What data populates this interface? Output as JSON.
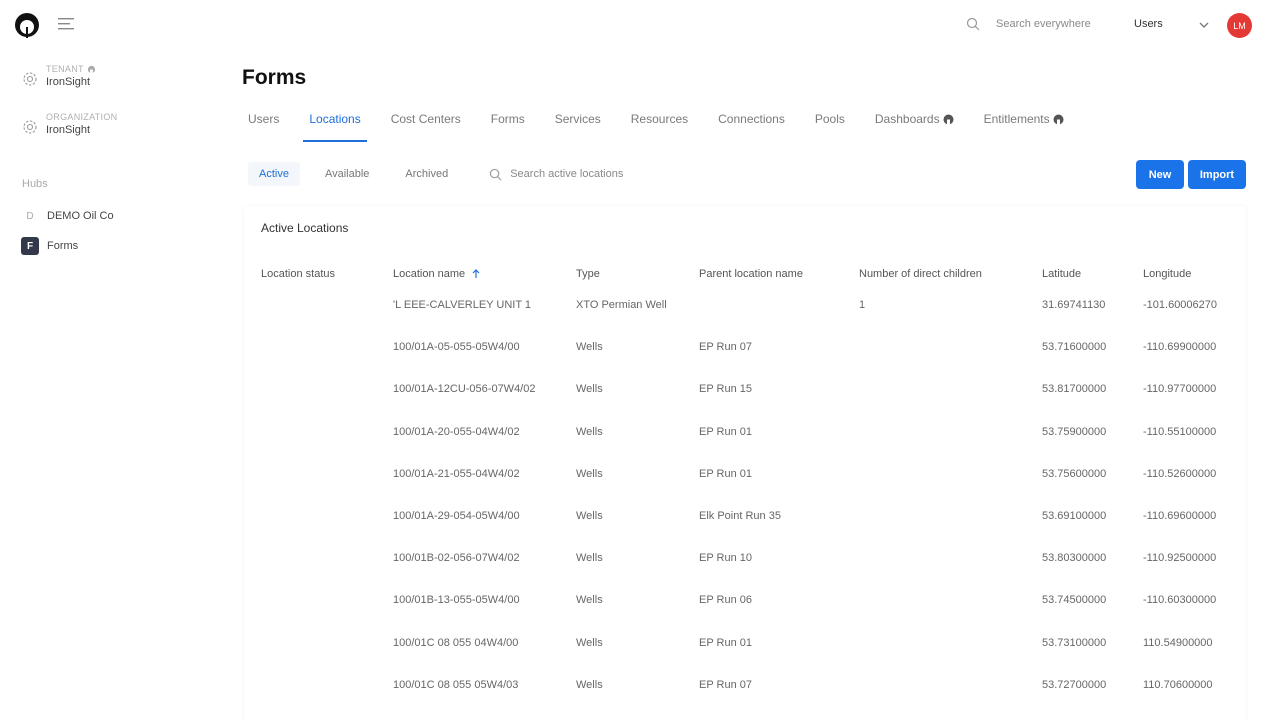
{
  "header": {
    "search_placeholder": "Search everywhere",
    "scope": "Users",
    "avatar_initials": "LM",
    "avatar_color": "#e53935"
  },
  "sidebar": {
    "tenant_label": "TENANT",
    "tenant_value": "IronSight",
    "org_label": "ORGANIZATION",
    "org_value": "IronSight",
    "hubs_title": "Hubs",
    "hubs": [
      {
        "badge": "D",
        "label": "DEMO Oil Co"
      },
      {
        "badge": "F",
        "label": "Forms"
      }
    ]
  },
  "page": {
    "title": "Forms",
    "tabs": [
      "Users",
      "Locations",
      "Cost Centers",
      "Forms",
      "Services",
      "Resources",
      "Connections",
      "Pools",
      "Dashboards",
      "Entitlements"
    ],
    "active_tab": "Locations",
    "subtabs": [
      "Active",
      "Available",
      "Archived"
    ],
    "active_subtab": "Active",
    "search_placeholder": "Search active locations",
    "new_button": "New",
    "import_button": "Import",
    "accent_color": "#1a73e8"
  },
  "table": {
    "title": "Active Locations",
    "columns": [
      "Location status",
      "Location name",
      "Type",
      "Parent location name",
      "Number of direct children",
      "Latitude",
      "Longitude"
    ],
    "sorted_column": "Location name",
    "sort_direction": "ascending",
    "rows": [
      [
        "",
        "'L EEE-CALVERLEY UNIT 1",
        "XTO Permian Well",
        "",
        "1",
        "31.69741130",
        "-101.60006270"
      ],
      [
        "",
        "100/01A-05-055-05W4/00",
        "Wells",
        "EP Run 07",
        "",
        "53.71600000",
        "-110.69900000"
      ],
      [
        "",
        "100/01A-12CU-056-07W4/02",
        "Wells",
        "EP Run 15",
        "",
        "53.81700000",
        "-110.97700000"
      ],
      [
        "",
        "100/01A-20-055-04W4/02",
        "Wells",
        "EP Run 01",
        "",
        "53.75900000",
        "-110.55100000"
      ],
      [
        "",
        "100/01A-21-055-04W4/02",
        "Wells",
        "EP Run 01",
        "",
        "53.75600000",
        "-110.52600000"
      ],
      [
        "",
        "100/01A-29-054-05W4/00",
        "Wells",
        "Elk Point Run 35",
        "",
        "53.69100000",
        "-110.69600000"
      ],
      [
        "",
        "100/01B-02-056-07W4/02",
        "Wells",
        "EP Run 10",
        "",
        "53.80300000",
        "-110.92500000"
      ],
      [
        "",
        "100/01B-13-055-05W4/00",
        "Wells",
        "EP Run 06",
        "",
        "53.74500000",
        "-110.60300000"
      ],
      [
        "",
        "100/01C 08 055 04W4/00",
        "Wells",
        "EP Run 01",
        "",
        "53.73100000",
        "110.54900000"
      ],
      [
        "",
        "100/01C 08 055 05W4/03",
        "Wells",
        "EP Run 07",
        "",
        "53.72700000",
        "110.70600000"
      ]
    ]
  }
}
